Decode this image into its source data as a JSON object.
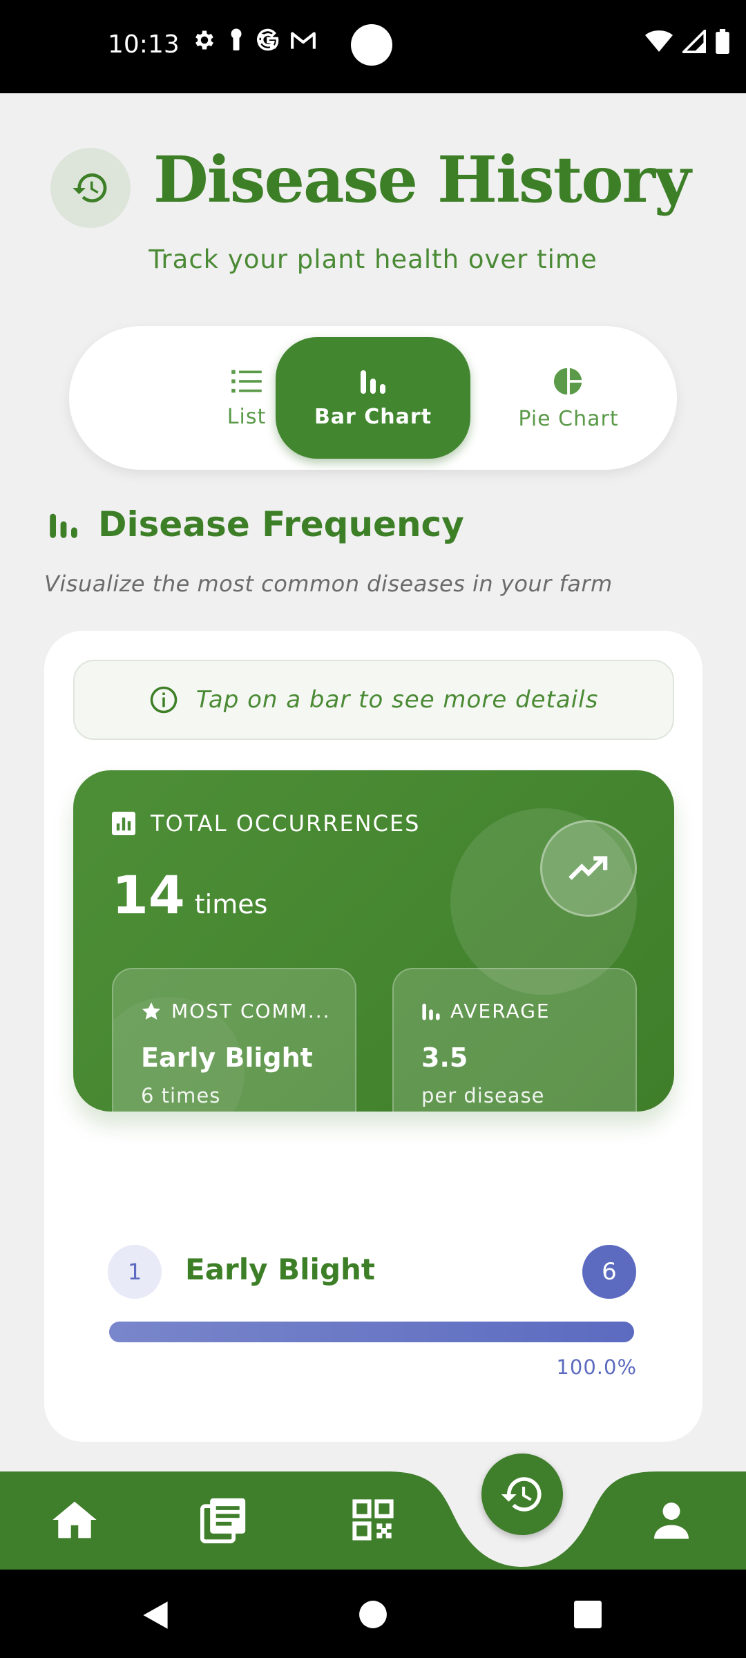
{
  "status_bar": {
    "time": "10:13",
    "left_icons": [
      "gear-icon",
      "key-icon",
      "google-icon",
      "gmail-icon",
      "dot-icon"
    ],
    "right_icons": [
      "wifi-icon",
      "signal-icon",
      "battery-icon"
    ]
  },
  "header": {
    "icon": "history-icon",
    "title": "Disease History",
    "subtitle": "Track your plant health over time"
  },
  "view_toggle": {
    "items": [
      {
        "label": "List",
        "icon": "list-icon",
        "active": false
      },
      {
        "label": "Bar Chart",
        "icon": "bar-chart-icon",
        "active": true
      },
      {
        "label": "Pie Chart",
        "icon": "pie-chart-icon",
        "active": false
      }
    ]
  },
  "section": {
    "title": "Disease Frequency",
    "subtitle": "Visualize the most common diseases in your farm"
  },
  "hint": {
    "icon": "info-icon",
    "text": "Tap on a bar to see more details"
  },
  "summary": {
    "label": "TOTAL OCCURRENCES",
    "value": "14",
    "unit": "times",
    "trend_icon": "trending-up-icon",
    "most_common": {
      "label": "MOST COMM...",
      "value": "Early Blight",
      "sub": "6 times"
    },
    "average": {
      "label": "AVERAGE",
      "value": "3.5",
      "sub": "per disease"
    }
  },
  "bars": [
    {
      "rank": "1",
      "label": "Early Blight",
      "count": "6",
      "percent_text": "100.0%",
      "fraction": 1.0
    }
  ],
  "colors": {
    "primary_green": "#3f7e2a",
    "bar_indigo": "#5c6bc0",
    "background": "#f0f0f0"
  },
  "bottom_nav": {
    "items": [
      "home-icon",
      "news-icon",
      "qr-code-icon",
      "history-icon",
      "person-icon"
    ],
    "active": "history-icon"
  },
  "android_nav": [
    "back-icon",
    "home-circle-icon",
    "recents-icon"
  ]
}
